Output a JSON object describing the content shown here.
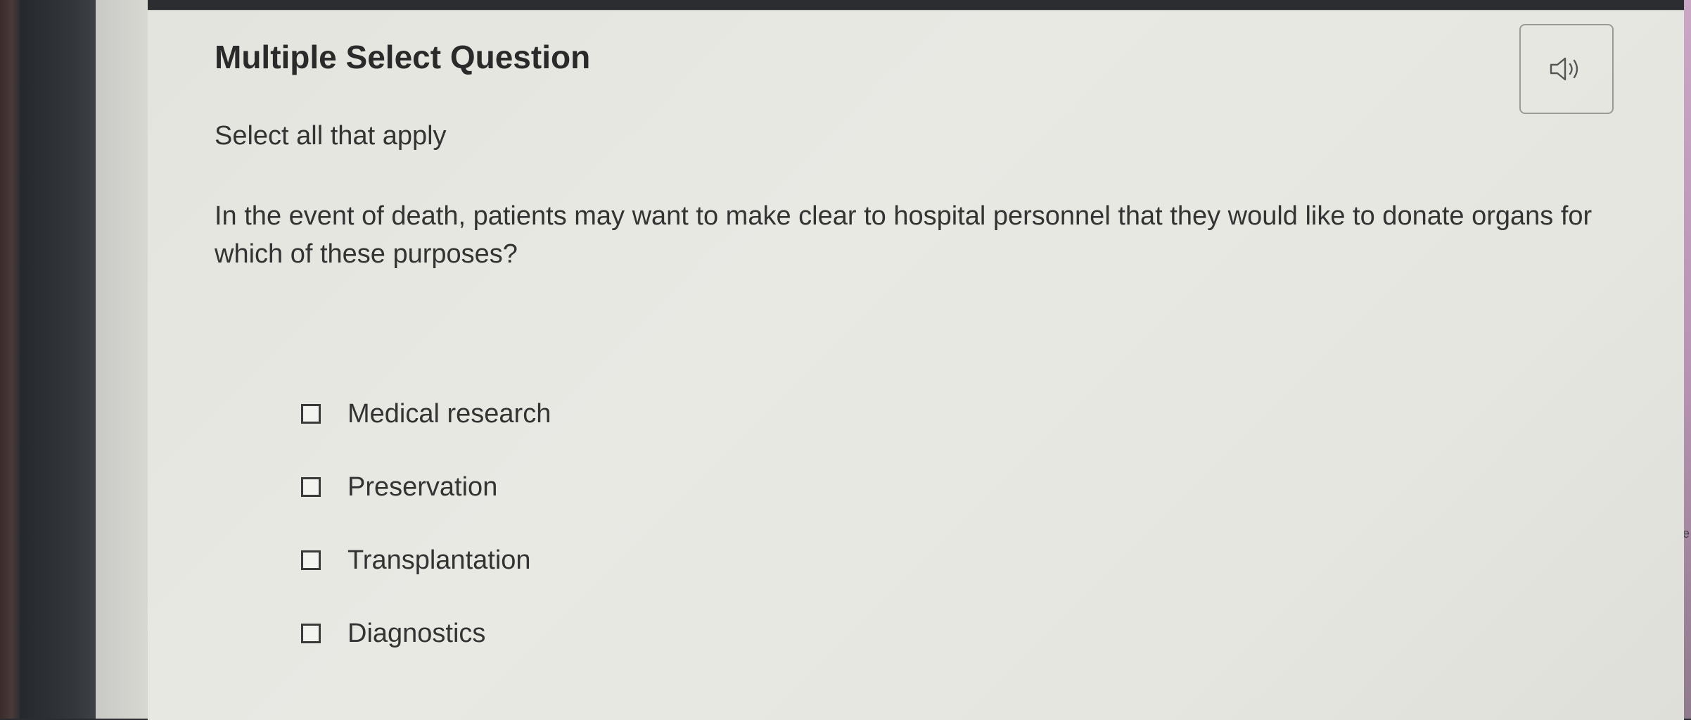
{
  "question": {
    "title": "Multiple Select Question",
    "instruction": "Select all that apply",
    "prompt": "In the event of death, patients may want to make clear to hospital personnel that they would like to donate organs for which of these purposes?"
  },
  "audio_button": {
    "icon": "speaker-icon"
  },
  "options": [
    {
      "label": "Medical research",
      "checked": false
    },
    {
      "label": "Preservation",
      "checked": false
    },
    {
      "label": "Transplantation",
      "checked": false
    },
    {
      "label": "Diagnostics",
      "checked": false
    }
  ],
  "edge_text": "e"
}
